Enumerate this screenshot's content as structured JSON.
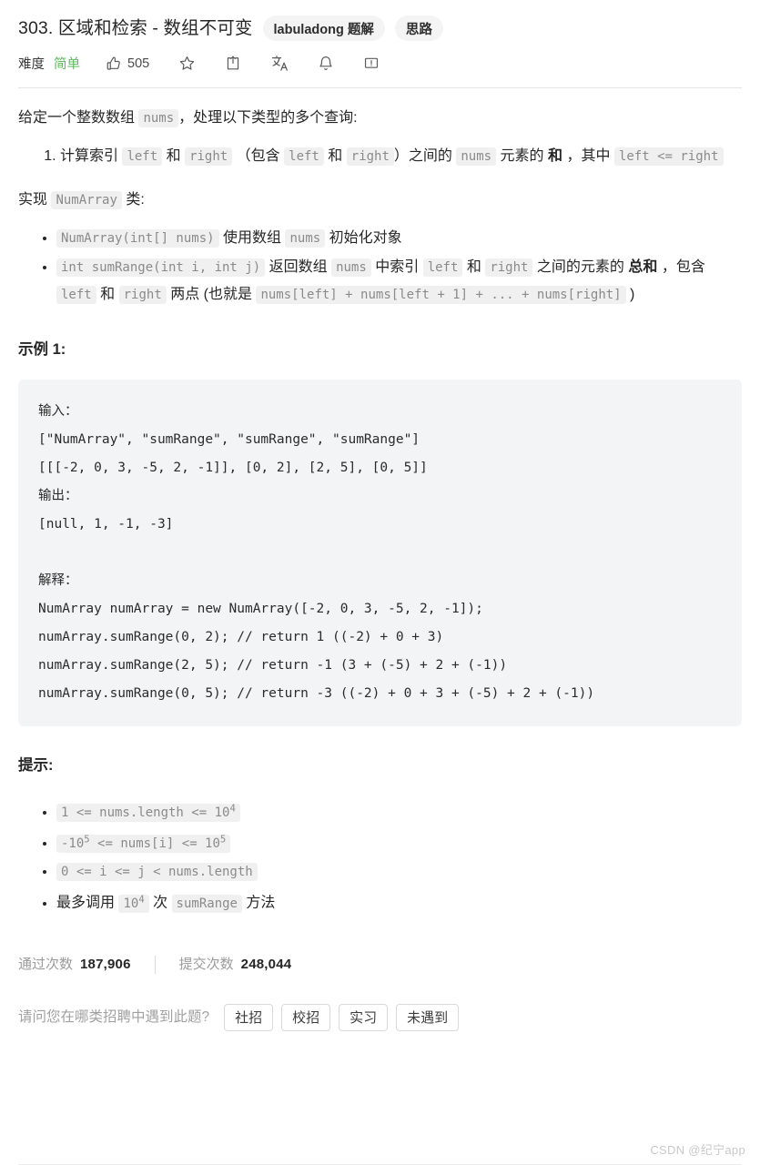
{
  "header": {
    "title": "303. 区域和检索 - 数组不可变",
    "badges": [
      {
        "label": "labuladong 题解"
      },
      {
        "label": "思路"
      }
    ],
    "difficulty_label": "难度",
    "difficulty_value": "简单",
    "difficulty_color": "#5cb85c",
    "likes": "505",
    "icons": [
      "thumbs-up-icon",
      "star-icon",
      "share-icon",
      "translate-icon",
      "bell-icon",
      "report-icon"
    ]
  },
  "description": {
    "intro_prefix": "给定一个整数数组 ",
    "intro_code": "nums",
    "intro_suffix": "，处理以下类型的多个查询:",
    "query_item": {
      "t1": "计算索引 ",
      "c1": "left",
      "t2": " 和 ",
      "c2": "right",
      "t3": " （包含 ",
      "c3": "left",
      "t4": " 和 ",
      "c4": "right",
      "t5": "）之间的 ",
      "c5": "nums",
      "t6": " 元素的 ",
      "bold": "和",
      "t7": " ，其中 ",
      "c6": "left <= right"
    },
    "implement_prefix": "实现 ",
    "implement_code": "NumArray",
    "implement_suffix": " 类:",
    "methods": [
      {
        "code": "NumArray(int[] nums)",
        "t1": " 使用数组 ",
        "code2": "nums",
        "t2": " 初始化对象"
      },
      {
        "code": "int sumRange(int i, int j)",
        "t1": " 返回数组 ",
        "code2": "nums",
        "t2": " 中索引 ",
        "code3": "left",
        "t3": " 和 ",
        "code4": "right",
        "t4": " 之间的元素的 ",
        "bold": "总和",
        "t5": " ，包含 ",
        "code5": "left",
        "t6": " 和 ",
        "code6": "right",
        "t7": " 两点 (也就是 ",
        "code7": "nums[left] + nums[left + 1] + ... + nums[right]",
        "t8": " )"
      }
    ]
  },
  "example": {
    "heading": "示例 1:",
    "code": "输入：\n[\"NumArray\", \"sumRange\", \"sumRange\", \"sumRange\"]\n[[[-2, 0, 3, -5, 2, -1]], [0, 2], [2, 5], [0, 5]]\n输出：\n[null, 1, -1, -3]\n\n解释：\nNumArray numArray = new NumArray([-2, 0, 3, -5, 2, -1]);\nnumArray.sumRange(0, 2); // return 1 ((-2) + 0 + 3)\nnumArray.sumRange(2, 5); // return -1 (3 + (-5) + 2 + (-1))\nnumArray.sumRange(0, 5); // return -3 ((-2) + 0 + 3 + (-5) + 2 + (-1))"
  },
  "hints": {
    "heading": "提示:",
    "items": [
      {
        "type": "code",
        "pre": "1 <= nums.length <= 10",
        "sup": "4",
        "post": ""
      },
      {
        "type": "code",
        "pre": "-10",
        "sup": "5",
        "post": " <= nums[i] <=  10",
        "sup2": "5"
      },
      {
        "type": "code",
        "pre": "0 <= i <= j < nums.length",
        "sup": "",
        "post": ""
      },
      {
        "type": "mixed",
        "t1": "最多调用 ",
        "c1": "10",
        "sup": "4",
        "t2": " 次 ",
        "c2": "sumRange",
        "t3": " 方法"
      }
    ]
  },
  "footer": {
    "accepted_label": "通过次数",
    "accepted_value": "187,906",
    "submissions_label": "提交次数",
    "submissions_value": "248,044",
    "survey_question": "请问您在哪类招聘中遇到此题?",
    "survey_options": [
      "社招",
      "校招",
      "实习",
      "未遇到"
    ],
    "watermark": "CSDN @纪宁app"
  }
}
